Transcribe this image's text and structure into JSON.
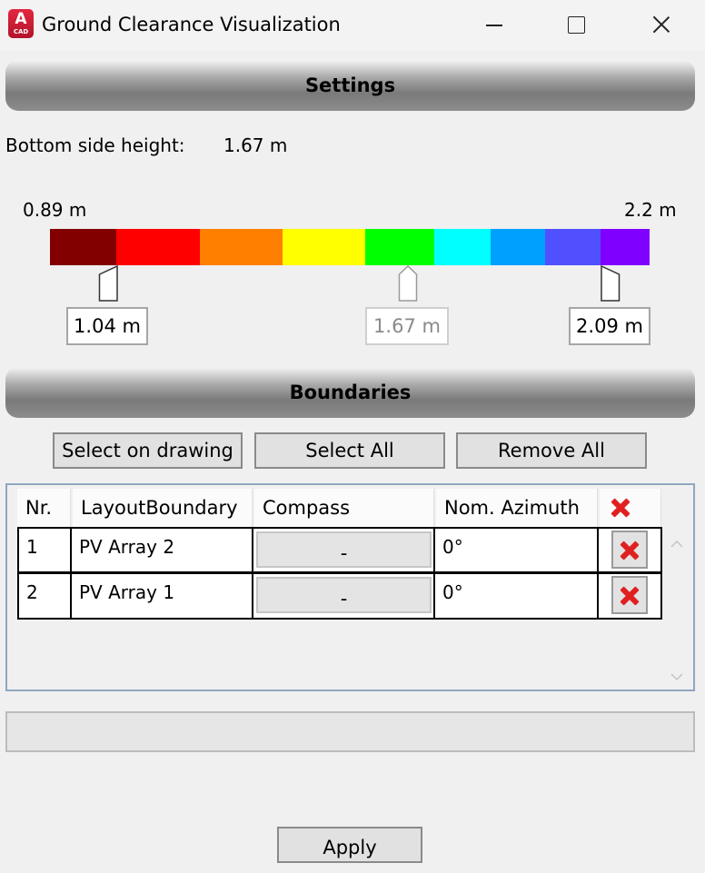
{
  "window": {
    "app_icon_letter": "A",
    "app_icon_sub": "CAD",
    "title": "Ground Clearance Visualization",
    "minimize_icon": "minimize-icon",
    "maximize_icon": "maximize-icon",
    "close_icon": "close-icon"
  },
  "settings": {
    "header": "Settings",
    "bottom_side_height_label": "Bottom side height:",
    "bottom_side_height_value": "1.67 m",
    "scale_min_label": "0.89 m",
    "scale_max_label": "2.2 m",
    "color_stops": [
      "#820000",
      "#ff0000",
      "#ff7f00",
      "#ffff00",
      "#00ff00",
      "#00ffff",
      "#00a0ff",
      "#5050ff",
      "#8000ff"
    ],
    "sliders": [
      {
        "value": "1.04 m",
        "enabled": true
      },
      {
        "value": "1.67 m",
        "enabled": false
      },
      {
        "value": "2.09 m",
        "enabled": true
      }
    ]
  },
  "boundaries": {
    "header": "Boundaries",
    "buttons": {
      "select_on_drawing": "Select on drawing",
      "select_all": "Select All",
      "remove_all": "Remove All"
    },
    "columns": [
      "Nr.",
      "LayoutBoundary",
      "Compass",
      "Nom. Azimuth"
    ],
    "delete_column_icon": "delete-icon",
    "rows": [
      {
        "nr": "1",
        "layout_boundary": "PV Array 2",
        "compass": "-",
        "nom_azimuth": "0°"
      },
      {
        "nr": "2",
        "layout_boundary": "PV Array 1",
        "compass": "-",
        "nom_azimuth": "0°"
      }
    ]
  },
  "footer": {
    "progress": 0,
    "apply": "Apply"
  }
}
